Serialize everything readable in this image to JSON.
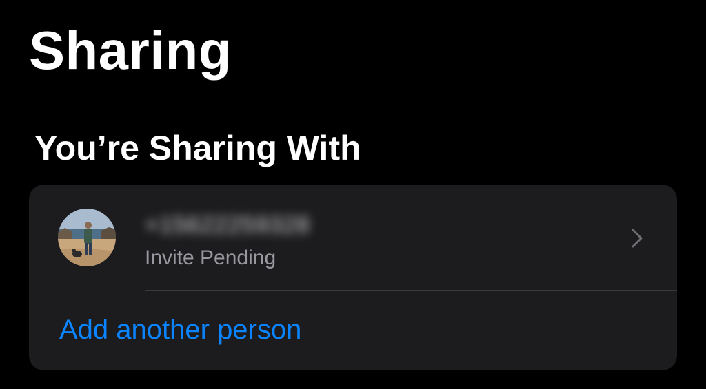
{
  "page": {
    "title": "Sharing"
  },
  "section": {
    "header": "You’re Sharing With"
  },
  "shared_person": {
    "name_redacted": "+15622259328",
    "status": "Invite Pending",
    "avatar_icon": "person-photo-avatar",
    "chevron_icon": "chevron-right-icon"
  },
  "actions": {
    "add_person_label": "Add another person"
  },
  "colors": {
    "background": "#000000",
    "card": "#1c1c1e",
    "accent": "#0a84ff",
    "secondary_text": "#98989f",
    "divider": "#3a3a3c"
  }
}
